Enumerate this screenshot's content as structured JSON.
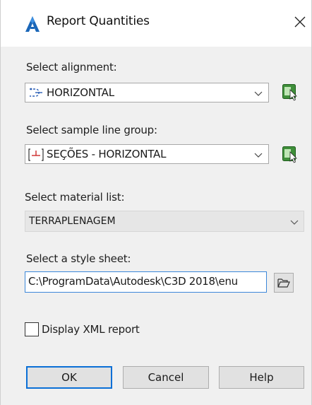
{
  "window": {
    "title": "Report Quantities"
  },
  "alignment": {
    "label": "Select alignment:",
    "value": "HORIZONTAL"
  },
  "sample_line_group": {
    "label": "Select sample line group:",
    "value": "SEÇÕES - HORIZONTAL"
  },
  "material_list": {
    "label": "Select material list:",
    "value": "TERRAPLENAGEM"
  },
  "style_sheet": {
    "label": "Select a style sheet:",
    "value": "C:\\ProgramData\\Autodesk\\C3D 2018\\enu"
  },
  "display_xml": {
    "label": "Display XML report",
    "checked": false
  },
  "buttons": {
    "ok": "OK",
    "cancel": "Cancel",
    "help": "Help"
  },
  "icons": {
    "app": "autodesk-app-icon",
    "close": "close-icon",
    "alignment": "alignment-icon",
    "sample_line_group": "sample-line-group-icon",
    "pick": "pick-from-drawing-icon",
    "browse": "folder-open-icon",
    "chevron": "chevron-down-icon"
  },
  "colors": {
    "accent": "#0a6fd6",
    "focus_border": "#3c87d9",
    "dialog_bg": "#f0f0f0",
    "icon_green": "#3f8f3a"
  }
}
